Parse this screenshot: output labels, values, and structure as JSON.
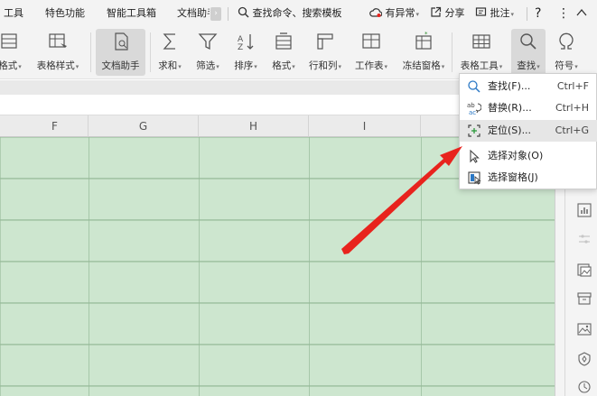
{
  "menubar": {
    "items": [
      {
        "label": "工具"
      },
      {
        "label": "特色功能"
      },
      {
        "label": "智能工具箱"
      },
      {
        "label": "文档助手"
      }
    ],
    "search_label": "查找命令、搜索模板",
    "anomaly_label": "有异常",
    "share_label": "分享",
    "comment_label": "批注"
  },
  "ribbon": {
    "buttons": [
      {
        "label": "格式",
        "icon": "cell-format-icon"
      },
      {
        "label": "表格样式",
        "icon": "table-style-icon"
      },
      {
        "label": "文档助手",
        "icon": "document-assistant-icon"
      },
      {
        "label": "求和",
        "icon": "sum-icon"
      },
      {
        "label": "筛选",
        "icon": "filter-icon"
      },
      {
        "label": "排序",
        "icon": "sort-icon"
      },
      {
        "label": "格式",
        "icon": "format-icon"
      },
      {
        "label": "行和列",
        "icon": "rows-columns-icon"
      },
      {
        "label": "工作表",
        "icon": "worksheet-icon"
      },
      {
        "label": "冻结窗格",
        "icon": "freeze-panes-icon"
      },
      {
        "label": "表格工具",
        "icon": "table-tools-icon"
      },
      {
        "label": "查找",
        "icon": "find-icon"
      },
      {
        "label": "符号",
        "icon": "symbol-icon"
      }
    ]
  },
  "sheet": {
    "columns": [
      "F",
      "G",
      "H",
      "I"
    ],
    "grid_color": "#cde6cf"
  },
  "dropdown": {
    "items": [
      {
        "label": "查找(F)...",
        "shortcut": "Ctrl+F",
        "icon": "search-icon"
      },
      {
        "label": "替换(R)...",
        "shortcut": "Ctrl+H",
        "icon": "replace-icon"
      },
      {
        "label": "定位(S)...",
        "shortcut": "Ctrl+G",
        "icon": "locate-icon"
      },
      {
        "label": "选择对象(O)",
        "shortcut": "",
        "icon": "cursor-icon"
      },
      {
        "label": "选择窗格(J)",
        "shortcut": "",
        "icon": "selection-pane-icon"
      }
    ]
  },
  "colors": {
    "accent_arrow": "#e8231d",
    "grid": "#cde6cf"
  }
}
